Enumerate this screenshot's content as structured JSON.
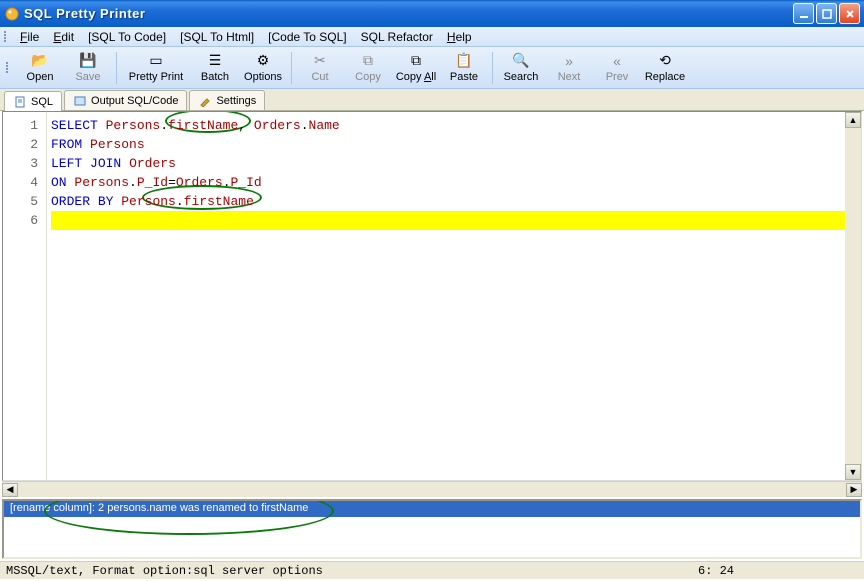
{
  "window": {
    "title": "SQL Pretty Printer"
  },
  "menus": {
    "file": "File",
    "edit": "Edit",
    "sql_to_code": "[SQL To Code]",
    "sql_to_html": "[SQL To Html]",
    "code_to_sql": "[Code To SQL]",
    "sql_refactor": "SQL Refactor",
    "help": "Help"
  },
  "toolbar": {
    "open": "Open",
    "save": "Save",
    "pretty_print": "Pretty Print",
    "batch": "Batch",
    "options": "Options",
    "cut": "Cut",
    "copy": "Copy",
    "copy_all": "Copy All",
    "paste": "Paste",
    "search": "Search",
    "next": "Next",
    "prev": "Prev",
    "replace": "Replace"
  },
  "tabs": {
    "sql": "SQL",
    "output": "Output SQL/Code",
    "settings": "Settings"
  },
  "editor": {
    "lines": [
      {
        "n": "1",
        "tokens": [
          [
            "kw",
            "SELECT"
          ],
          [
            "plain",
            " "
          ],
          [
            "ident",
            "Persons"
          ],
          [
            "op",
            "."
          ],
          [
            "ident",
            "firstName"
          ],
          [
            "op",
            ","
          ],
          [
            "plain",
            " "
          ],
          [
            "ident",
            "Orders"
          ],
          [
            "op",
            "."
          ],
          [
            "ident",
            "Name"
          ]
        ]
      },
      {
        "n": "2",
        "tokens": [
          [
            "kw",
            "FROM"
          ],
          [
            "plain",
            " "
          ],
          [
            "ident",
            "Persons"
          ]
        ]
      },
      {
        "n": "3",
        "tokens": [
          [
            "kw",
            "LEFT"
          ],
          [
            "plain",
            " "
          ],
          [
            "kw",
            "JOIN"
          ],
          [
            "plain",
            " "
          ],
          [
            "ident",
            "Orders"
          ]
        ]
      },
      {
        "n": "4",
        "tokens": [
          [
            "kw",
            "ON"
          ],
          [
            "plain",
            " "
          ],
          [
            "ident",
            "Persons"
          ],
          [
            "op",
            "."
          ],
          [
            "ident",
            "P_Id"
          ],
          [
            "op",
            "="
          ],
          [
            "ident",
            "Orders"
          ],
          [
            "op",
            "."
          ],
          [
            "ident",
            "P_Id"
          ]
        ]
      },
      {
        "n": "5",
        "tokens": [
          [
            "kw",
            "ORDER"
          ],
          [
            "plain",
            " "
          ],
          [
            "kw",
            "BY"
          ],
          [
            "plain",
            " "
          ],
          [
            "ident",
            "Persons"
          ],
          [
            "op",
            "."
          ],
          [
            "ident",
            "firstName"
          ]
        ]
      },
      {
        "n": "6",
        "tokens": []
      }
    ],
    "current_line": 6
  },
  "message": "[rename column]: 2 persons.name was renamed to firstName",
  "status": {
    "left": "MSSQL/text, Format option:sql server options",
    "right": "6: 24"
  }
}
